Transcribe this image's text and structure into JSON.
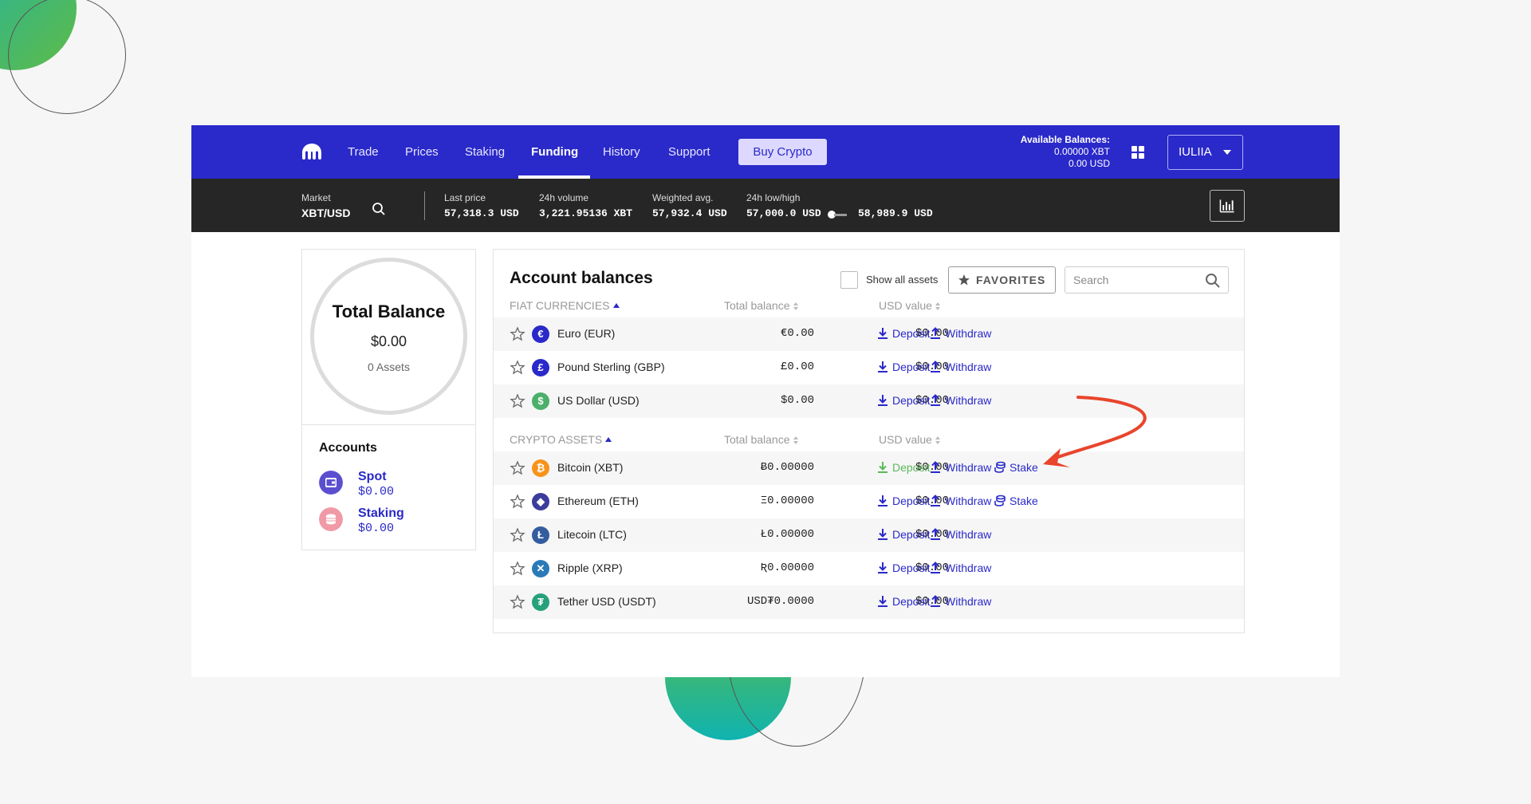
{
  "nav": {
    "items": [
      {
        "label": "Trade",
        "active": false
      },
      {
        "label": "Prices",
        "active": false
      },
      {
        "label": "Staking",
        "active": false
      },
      {
        "label": "Funding",
        "active": true
      },
      {
        "label": "History",
        "active": false
      },
      {
        "label": "Support",
        "active": false
      }
    ],
    "buy_label": "Buy Crypto",
    "available": {
      "title": "Available Balances:",
      "xbt": "0.00000 XBT",
      "usd": "0.00 USD"
    },
    "user_label": "IULIIA",
    "accent": "#2a29c9"
  },
  "ticker": {
    "market_label": "Market",
    "pair": "XBT/USD",
    "last_price": {
      "label": "Last price",
      "value": "57,318.3 USD"
    },
    "volume": {
      "label": "24h volume",
      "value": "3,221.95136 XBT"
    },
    "weighted": {
      "label": "Weighted avg.",
      "value": "57,932.4 USD"
    },
    "lowhigh": {
      "label": "24h low/high",
      "low": "57,000.0 USD",
      "high": "58,989.9 USD"
    }
  },
  "total": {
    "title": "Total Balance",
    "value": "$0.00",
    "assets": "0 Assets"
  },
  "accounts": {
    "title": "Accounts",
    "items": [
      {
        "name": "Spot",
        "value": "$0.00",
        "icon": "wallet-icon",
        "color": "#5b4fd0"
      },
      {
        "name": "Staking",
        "value": "$0.00",
        "icon": "coins-stack-icon",
        "color": "#ef9aa6"
      }
    ]
  },
  "balances": {
    "title": "Account balances",
    "show_all_label": "Show all assets",
    "favorites_label": "FAVORITES",
    "search_placeholder": "Search",
    "fiat": {
      "header": "FIAT CURRENCIES",
      "col_total": "Total balance",
      "col_usd": "USD value",
      "rows": [
        {
          "name": "Euro (EUR)",
          "symbol": "€",
          "color": "#2a29c9",
          "balance": "€0.00",
          "usd": "$0.00",
          "deposit": "Deposit",
          "withdraw": "Withdraw"
        },
        {
          "name": "Pound Sterling (GBP)",
          "symbol": "£",
          "color": "#2a29c9",
          "balance": "£0.00",
          "usd": "$0.00",
          "deposit": "Deposit",
          "withdraw": "Withdraw"
        },
        {
          "name": "US Dollar (USD)",
          "symbol": "$",
          "color": "#4caf6a",
          "balance": "$0.00",
          "usd": "$0.00",
          "deposit": "Deposit",
          "withdraw": "Withdraw"
        }
      ]
    },
    "crypto": {
      "header": "CRYPTO ASSETS",
      "col_total": "Total balance",
      "col_usd": "USD value",
      "rows": [
        {
          "name": "Bitcoin (XBT)",
          "symbol": "₿",
          "color": "#f7931a",
          "balance": "Ƀ0.00000",
          "usd": "$0.00",
          "deposit": "Deposit",
          "withdraw": "Withdraw",
          "stake": "Stake"
        },
        {
          "name": "Ethereum (ETH)",
          "symbol": "◆",
          "color": "#3c3c9d",
          "balance": "Ξ0.00000",
          "usd": "$0.00",
          "deposit": "Deposit",
          "withdraw": "Withdraw",
          "stake": "Stake"
        },
        {
          "name": "Litecoin (LTC)",
          "symbol": "Ł",
          "color": "#345d9d",
          "balance": "Ł0.00000",
          "usd": "$0.00",
          "deposit": "Deposit",
          "withdraw": "Withdraw"
        },
        {
          "name": "Ripple (XRP)",
          "symbol": "✕",
          "color": "#2a7ab8",
          "balance": "Ʀ0.00000",
          "usd": "$0.00",
          "deposit": "Deposit",
          "withdraw": "Withdraw"
        },
        {
          "name": "Tether USD (USDT)",
          "symbol": "₮",
          "color": "#26a17b",
          "balance": "USD₮0.0000",
          "usd": "$0.00",
          "deposit": "Deposit",
          "withdraw": "Withdraw"
        }
      ]
    }
  },
  "colors": {
    "deposit_highlight": "#5cb85c",
    "arrow": "#e8452c"
  }
}
